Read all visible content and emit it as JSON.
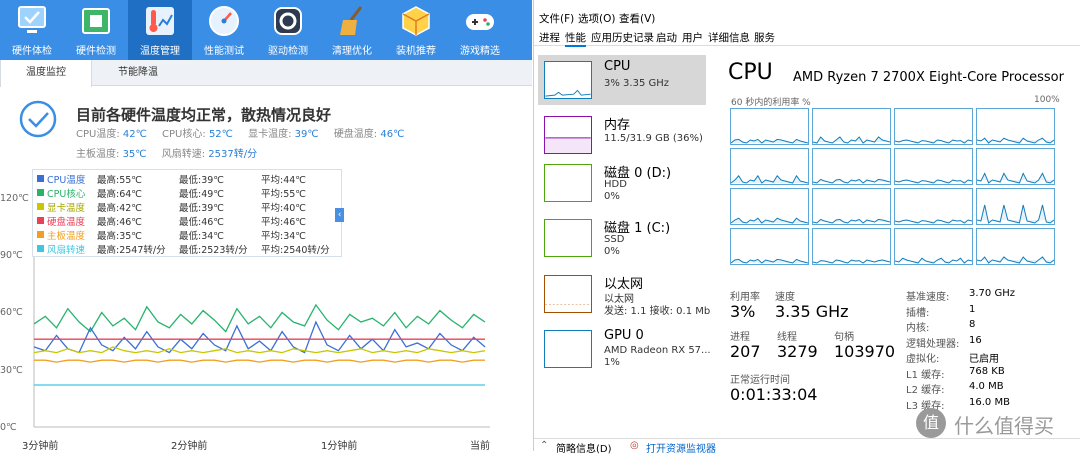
{
  "left_app": {
    "toolbar": [
      {
        "label": "硬件体检",
        "icon": "monitor-check-icon"
      },
      {
        "label": "硬件检测",
        "icon": "circuit-board-icon"
      },
      {
        "label": "温度管理",
        "icon": "thermometer-icon"
      },
      {
        "label": "性能测试",
        "icon": "speedometer-icon"
      },
      {
        "label": "驱动检测",
        "icon": "gear-cube-icon"
      },
      {
        "label": "清理优化",
        "icon": "broom-icon"
      },
      {
        "label": "装机推荐",
        "icon": "package-icon"
      },
      {
        "label": "游戏精选",
        "icon": "gamepad-icon"
      }
    ],
    "active_tool_index": 2,
    "subtabs": [
      "温度监控",
      "节能降温"
    ],
    "status_text": "目前各硬件温度均正常，散热情况良好",
    "stats": {
      "cpu_temp_label": "CPU温度:",
      "cpu_temp": "42℃",
      "cpu_core_label": "CPU核心:",
      "cpu_core": "52℃",
      "gpu_temp_label": "显卡温度:",
      "gpu_temp": "39℃",
      "disk_temp_label": "硬盘温度:",
      "disk_temp": "46℃",
      "board_temp_label": "主板温度:",
      "board_temp": "35℃",
      "fan_label": "风扇转速:",
      "fan": "2537转/分"
    },
    "legend": [
      {
        "name": "CPU温度",
        "max": "最高:55℃",
        "min": "最低:39℃",
        "avg": "平均:44℃",
        "color": "#3b6fd6"
      },
      {
        "name": "CPU核心",
        "max": "最高:64℃",
        "min": "最低:49℃",
        "avg": "平均:55℃",
        "color": "#27b36d"
      },
      {
        "name": "显卡温度",
        "max": "最高:42℃",
        "min": "最低:39℃",
        "avg": "平均:40℃",
        "color": "#c8c800"
      },
      {
        "name": "硬盘温度",
        "max": "最高:46℃",
        "min": "最低:46℃",
        "avg": "平均:46℃",
        "color": "#e8425a"
      },
      {
        "name": "主板温度",
        "max": "最高:35℃",
        "min": "最低:34℃",
        "avg": "平均:34℃",
        "color": "#f0a020"
      },
      {
        "name": "风扇转速",
        "max": "最高:2547转/分",
        "min": "最低:2523转/分",
        "avg": "平均:2540转/分",
        "color": "#3ec8e0"
      }
    ],
    "y_ticks": [
      "120℃",
      "90℃",
      "60℃",
      "30℃",
      "0℃"
    ],
    "x_ticks": [
      "3分钟前",
      "2分钟前",
      "1分钟前",
      "当前"
    ]
  },
  "chart_data": {
    "type": "line",
    "title": "",
    "xlabel": "",
    "ylabel": "",
    "ylim": [
      0,
      120
    ],
    "grid": false,
    "series": [
      {
        "name": "CPU核心",
        "color": "#27b36d",
        "values": [
          54,
          58,
          52,
          62,
          55,
          50,
          60,
          53,
          57,
          51,
          63,
          55,
          52,
          59,
          54,
          61,
          56,
          50,
          62,
          54,
          58,
          52,
          60,
          55,
          53,
          64,
          56,
          51,
          59,
          55,
          57,
          53,
          60,
          52,
          58,
          54,
          61,
          56,
          52,
          59,
          55
        ]
      },
      {
        "name": "CPU温度",
        "color": "#3b6fd6",
        "values": [
          42,
          40,
          48,
          41,
          39,
          52,
          43,
          40,
          47,
          41,
          50,
          42,
          39,
          46,
          41,
          49,
          43,
          40,
          53,
          41,
          45,
          40,
          50,
          42,
          39,
          55,
          43,
          40,
          48,
          41,
          46,
          40,
          51,
          42,
          44,
          41,
          49,
          43,
          40,
          47,
          42
        ]
      },
      {
        "name": "硬盘温度",
        "color": "#e8425a",
        "values": [
          46,
          46,
          46,
          46,
          46,
          46,
          46,
          46,
          46,
          46,
          46,
          46,
          46,
          46,
          46,
          46,
          46,
          46,
          46,
          46,
          46,
          46,
          46,
          46,
          46,
          46,
          46,
          46,
          46,
          46,
          46,
          46,
          46,
          46,
          46,
          46,
          46,
          46,
          46,
          46,
          46
        ]
      },
      {
        "name": "显卡温度",
        "color": "#c8c800",
        "values": [
          39,
          40,
          39,
          41,
          39,
          40,
          39,
          42,
          40,
          39,
          40,
          39,
          41,
          39,
          40,
          39,
          40,
          41,
          39,
          40,
          39,
          40,
          39,
          41,
          40,
          39,
          40,
          39,
          40,
          41,
          39,
          40,
          39,
          40,
          39,
          41,
          40,
          39,
          40,
          39,
          40
        ]
      },
      {
        "name": "主板温度",
        "color": "#f0a020",
        "values": [
          35,
          35,
          34,
          35,
          35,
          34,
          35,
          35,
          34,
          35,
          35,
          34,
          35,
          35,
          34,
          35,
          35,
          34,
          35,
          35,
          34,
          35,
          35,
          34,
          35,
          35,
          34,
          35,
          35,
          34,
          35,
          35,
          34,
          35,
          35,
          34,
          35,
          35,
          34,
          35,
          35
        ]
      },
      {
        "name": "风扇转速",
        "color": "#3ec8e0",
        "values": [
          22,
          22,
          22,
          22,
          22,
          22,
          22,
          22,
          22,
          22,
          22,
          22,
          22,
          22,
          22,
          22,
          22,
          22,
          22,
          22,
          22,
          22,
          22,
          22,
          22,
          22,
          22,
          22,
          22,
          22,
          22,
          22,
          22,
          22,
          22,
          22,
          22,
          22,
          22,
          22,
          22
        ]
      }
    ]
  },
  "task_manager": {
    "menu": [
      "文件(F)",
      "选项(O)",
      "查看(V)"
    ],
    "tabs": [
      "进程",
      "性能",
      "应用历史记录",
      "启动",
      "用户",
      "详细信息",
      "服务"
    ],
    "active_tab_index": 1,
    "side": [
      {
        "name": "CPU",
        "line1": "3% 3.35 GHz",
        "line2": "",
        "color": "#117dbb"
      },
      {
        "name": "内存",
        "line1": "11.5/31.9 GB (36%)",
        "line2": "",
        "color": "#8b12ae"
      },
      {
        "name": "磁盘 0 (D:)",
        "line1": "HDD",
        "line2": "0%",
        "color": "#4da60c"
      },
      {
        "name": "磁盘 1 (C:)",
        "line1": "SSD",
        "line2": "0%",
        "color": "#4da60c"
      },
      {
        "name": "以太网",
        "line1": "以太网",
        "line2": "发送: 1.1  接收: 0.1 Mb",
        "color": "#a74f01"
      },
      {
        "name": "GPU 0",
        "line1": "AMD Radeon RX 57...",
        "line2": "1%",
        "color": "#117dbb"
      }
    ],
    "cpu": {
      "title": "CPU",
      "processor": "AMD Ryzen 7 2700X Eight-Core Processor",
      "graph_caption": "60 秒内的利用率 %",
      "graph_max": "100%",
      "util_label": "利用率",
      "util": "3%",
      "speed_label": "速度",
      "speed": "3.35 GHz",
      "proc_label": "进程",
      "proc": "207",
      "thread_label": "线程",
      "thread": "3279",
      "handle_label": "句柄",
      "handle": "103970",
      "uptime_label": "正常运行时间",
      "uptime": "0:01:33:04",
      "details": [
        {
          "k": "基准速度:",
          "v": "3.70 GHz"
        },
        {
          "k": "插槽:",
          "v": "1"
        },
        {
          "k": "内核:",
          "v": "8"
        },
        {
          "k": "逻辑处理器:",
          "v": "16"
        },
        {
          "k": "虚拟化:",
          "v": "已启用"
        },
        {
          "k": "L1 缓存:",
          "v": "768 KB"
        },
        {
          "k": "L2 缓存:",
          "v": "4.0 MB"
        },
        {
          "k": "L3 缓存:",
          "v": "16.0 MB"
        }
      ]
    },
    "footer": {
      "summary": "简略信息(D)",
      "open_monitor": "打开资源监视器"
    }
  },
  "watermark": {
    "symbol": "值",
    "text": "什么值得买"
  }
}
